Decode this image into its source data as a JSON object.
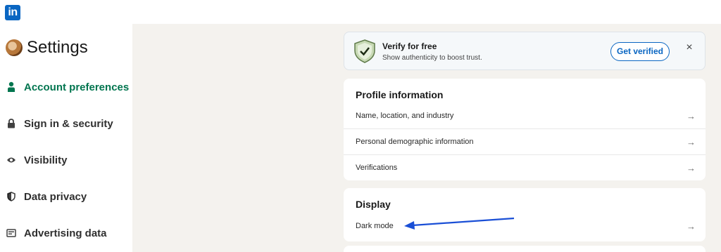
{
  "brand": {
    "logo_text": "in"
  },
  "sidebar": {
    "title": "Settings",
    "items": [
      {
        "label": "Account preferences",
        "icon": "person-icon",
        "active": true
      },
      {
        "label": "Sign in & security",
        "icon": "lock-icon",
        "active": false
      },
      {
        "label": "Visibility",
        "icon": "eye-icon",
        "active": false
      },
      {
        "label": "Data privacy",
        "icon": "shield-icon",
        "active": false
      },
      {
        "label": "Advertising data",
        "icon": "newspaper-icon",
        "active": false
      }
    ]
  },
  "verify": {
    "title": "Verify for free",
    "subtitle": "Show authenticity to boost trust.",
    "button_label": "Get verified",
    "close_label": "×"
  },
  "profile": {
    "title": "Profile information",
    "rows": [
      {
        "label": "Name, location, and industry",
        "arrow": "→"
      },
      {
        "label": "Personal demographic information",
        "arrow": "→"
      },
      {
        "label": "Verifications",
        "arrow": "→"
      }
    ]
  },
  "display": {
    "title": "Display",
    "rows": [
      {
        "label": "Dark mode",
        "arrow": "→"
      }
    ]
  },
  "colors": {
    "brand_blue": "#0a66c2",
    "active_green": "#01754f",
    "annotation_arrow": "#1a4fd6",
    "page_bg": "#f4f2ee"
  }
}
